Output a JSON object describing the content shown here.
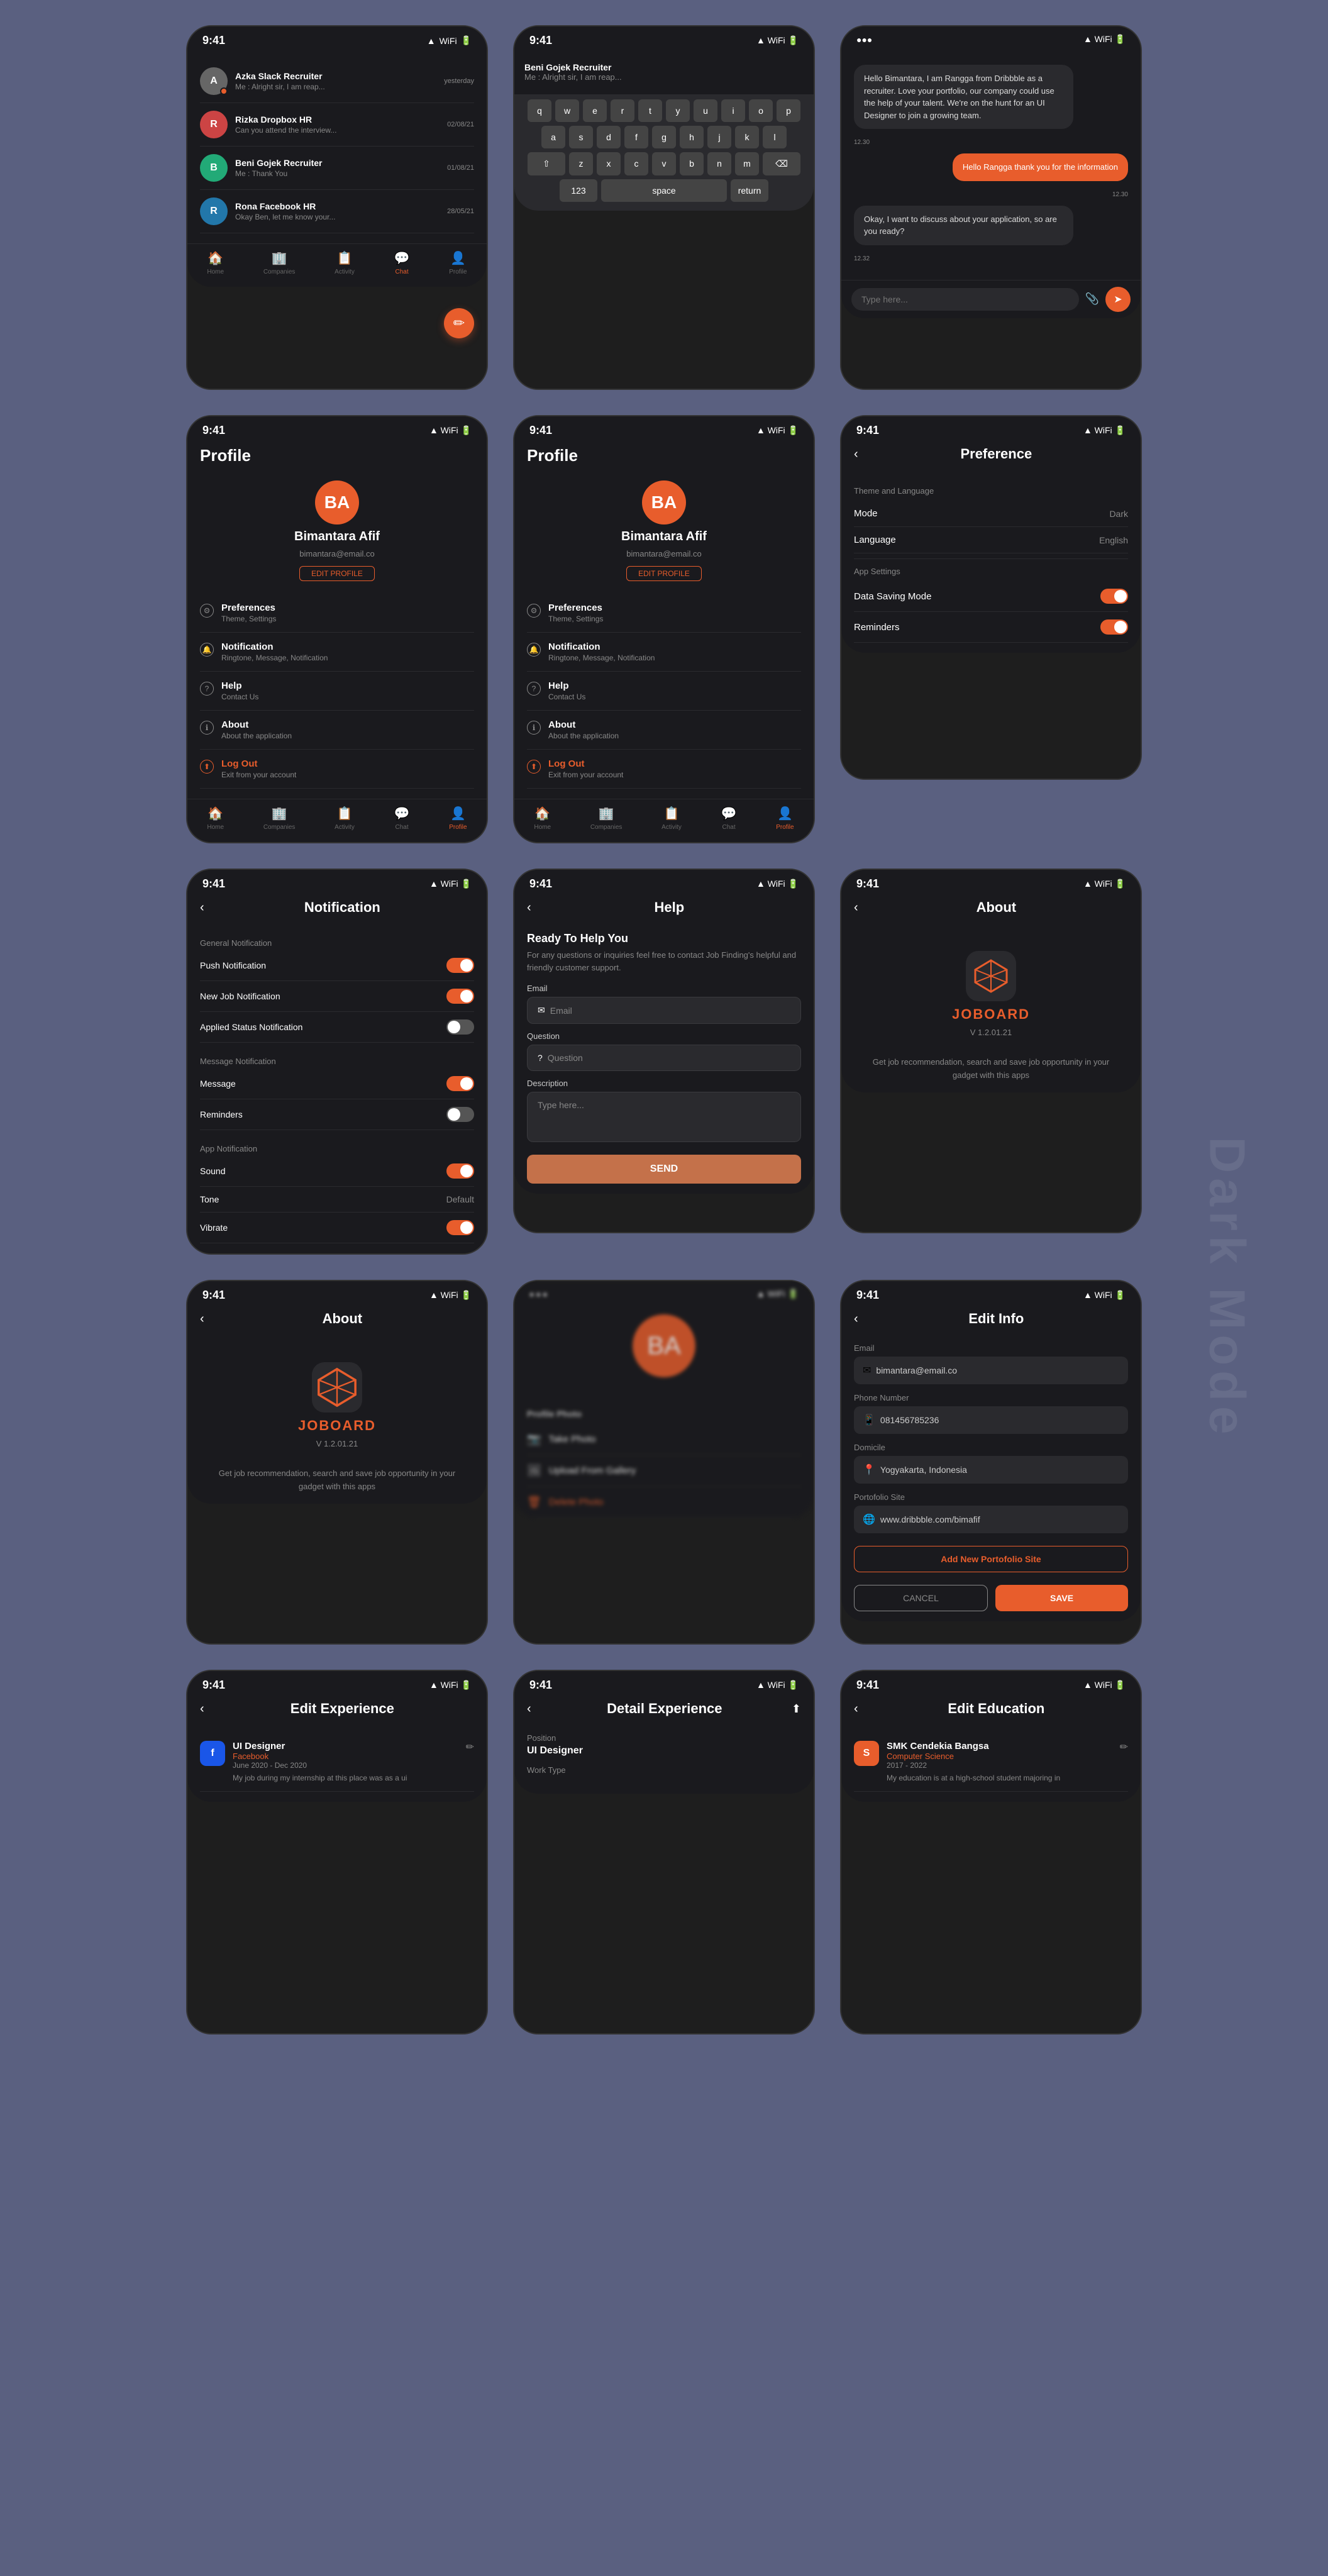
{
  "app": {
    "watermark": "Dark Mode"
  },
  "row1": {
    "phone1": {
      "status": {
        "time": "9:41",
        "icons": "▲ WiFi 🔋"
      },
      "chats": [
        {
          "name": "Azka Slack Recruiter",
          "preview": "Me : Alright sir, I am reap...",
          "time": "yesterday",
          "avatar": "A"
        },
        {
          "name": "Rizka Dropbox HR",
          "preview": "Can you attend the interview...",
          "time": "02/08/21",
          "avatar": "R"
        },
        {
          "name": "Beni Gojek Recruiter",
          "preview": "Me : Thank You",
          "time": "01/08/21",
          "avatar": "B"
        },
        {
          "name": "Rona Facebook HR",
          "preview": "Okay Ben, let me know your...",
          "time": "28/05/21",
          "avatar": "R2"
        }
      ],
      "fab": "+"
    },
    "phone2": {
      "status": {
        "time": "9:41"
      },
      "type": "keyboard-chat",
      "preview": "Me : Alright sir, I am reap...",
      "keyboard_rows": [
        [
          "q",
          "w",
          "e",
          "r",
          "t",
          "y",
          "u",
          "i",
          "o",
          "p"
        ],
        [
          "a",
          "s",
          "d",
          "f",
          "g",
          "h",
          "j",
          "k",
          "l"
        ],
        [
          "⇧",
          "z",
          "x",
          "c",
          "v",
          "b",
          "n",
          "m",
          "⌫"
        ],
        [
          "123",
          "space",
          "return"
        ]
      ]
    },
    "phone3": {
      "status": {
        "time": ""
      },
      "type": "message-thread",
      "messages": [
        {
          "type": "received",
          "text": "Hello Bimantara, I am Rangga from Dribbble as a recruiter. Love your portfolio, our company could use the help of your talent. We're on the hunt for an UI Designer to join a growing team.",
          "time": "12.30"
        },
        {
          "type": "sent",
          "text": "Hello Rangga thank you for the information",
          "time": "12.30"
        },
        {
          "type": "received",
          "text": "Okay, I want to discuss about your application, so are you ready?",
          "time": "12.32"
        }
      ],
      "input_placeholder": "Type here..."
    }
  },
  "row2": {
    "phone1": {
      "status": {
        "time": "9:41"
      },
      "type": "profile",
      "name": "Bimantara Afif",
      "email": "bimantara@email.co",
      "edit_label": "EDIT PROFILE",
      "menu_items": [
        {
          "icon": "⚙",
          "title": "Preferences",
          "subtitle": "Theme, Settings"
        },
        {
          "icon": "🔔",
          "title": "Notification",
          "subtitle": "Ringtone, Message, Notification"
        },
        {
          "icon": "?",
          "title": "Help",
          "subtitle": "Contact Us"
        },
        {
          "icon": "ℹ",
          "title": "About",
          "subtitle": "About the application"
        },
        {
          "icon": "⬆",
          "title": "Log Out",
          "subtitle": "Exit from your account",
          "type": "logout"
        }
      ],
      "nav": [
        "Home",
        "Companies",
        "Activity",
        "Chat",
        "Profile"
      ]
    },
    "phone2": {
      "status": {
        "time": "9:41"
      },
      "type": "profile",
      "name": "Bimantara Afif",
      "email": "bimantara@email.co",
      "edit_label": "EDIT PROFILE",
      "menu_items": [
        {
          "icon": "⚙",
          "title": "Preferences",
          "subtitle": "Theme, Settings"
        },
        {
          "icon": "🔔",
          "title": "Notification",
          "subtitle": "Ringtone, Message, Notification"
        },
        {
          "icon": "?",
          "title": "Help",
          "subtitle": "Contact Us"
        },
        {
          "icon": "ℹ",
          "title": "About",
          "subtitle": "About the application"
        },
        {
          "icon": "⬆",
          "title": "Log Out",
          "subtitle": "Exit from your account",
          "type": "logout"
        }
      ],
      "nav": [
        "Home",
        "Companies",
        "Activity",
        "Chat",
        "Profile"
      ]
    },
    "phone3": {
      "status": {
        "time": "9:41"
      },
      "type": "preference",
      "title": "Preference",
      "sections": [
        {
          "header": "Theme and Language",
          "items": [
            {
              "label": "Mode",
              "value": "Dark",
              "type": "text"
            },
            {
              "label": "Language",
              "value": "English",
              "type": "text"
            }
          ]
        },
        {
          "header": "App Settings",
          "items": [
            {
              "label": "Data Saving Mode",
              "value": "",
              "type": "toggle",
              "state": "on"
            },
            {
              "label": "Reminders",
              "value": "",
              "type": "toggle",
              "state": "on"
            }
          ]
        }
      ]
    }
  },
  "row3": {
    "phone1": {
      "status": {
        "time": "9:41"
      },
      "type": "notification",
      "title": "Notification",
      "sections": [
        {
          "header": "General Notification",
          "items": [
            {
              "label": "Push Notification",
              "type": "toggle",
              "state": "on"
            },
            {
              "label": "New Job Notification",
              "type": "toggle",
              "state": "on"
            },
            {
              "label": "Applied Status Notification",
              "type": "toggle",
              "state": "off"
            }
          ]
        },
        {
          "header": "Message Notification",
          "items": [
            {
              "label": "Message",
              "type": "toggle",
              "state": "on"
            },
            {
              "label": "Reminders",
              "type": "toggle",
              "state": "off"
            }
          ]
        },
        {
          "header": "App Notification",
          "items": [
            {
              "label": "Sound",
              "type": "toggle",
              "state": "on"
            },
            {
              "label": "Tone",
              "type": "text",
              "value": "Default"
            },
            {
              "label": "Vibrate",
              "type": "toggle",
              "state": "on"
            }
          ]
        }
      ]
    },
    "phone2": {
      "status": {
        "time": "9:41"
      },
      "type": "help",
      "title": "Help",
      "ready_title": "Ready To Help You",
      "ready_subtitle": "For any questions or inquiries feel free to contact Job Finding's helpful and friendly customer support.",
      "fields": [
        {
          "label": "Email",
          "placeholder": "Email",
          "icon": "✉"
        },
        {
          "label": "Question",
          "placeholder": "Question",
          "icon": "?"
        },
        {
          "label": "Description",
          "placeholder": "Type here...",
          "type": "textarea"
        }
      ],
      "submit_label": "SEND"
    },
    "phone3": {
      "status": {
        "time": "9:41"
      },
      "type": "about",
      "title": "About",
      "logo_name": "JOBOARD",
      "version": "V 1.2.01.21",
      "description": "Get job recommendation, search and save job opportunity in your gadget with this apps"
    }
  },
  "row4": {
    "phone1": {
      "status": {
        "time": "9:41"
      },
      "type": "about",
      "title": "About",
      "logo_name": "JOBOARD",
      "version": "V 1.2.01.21",
      "description": "Get job recommendation, search and save job opportunity in your gadget with this apps"
    },
    "phone2": {
      "status": {
        "time": ""
      },
      "type": "profile-photo",
      "blurred": true,
      "profile_photo_title": "Profile Photo",
      "options": [
        {
          "icon": "📷",
          "label": "Take Photo"
        },
        {
          "icon": "🖼",
          "label": "Upload From Gallery"
        },
        {
          "icon": "🗑",
          "label": "Delete Photo",
          "type": "delete"
        }
      ]
    },
    "phone3": {
      "status": {
        "time": "9:41"
      },
      "type": "edit-info",
      "title": "Edit Info",
      "fields": [
        {
          "label": "Email",
          "icon": "✉",
          "value": "bimantara@email.co"
        },
        {
          "label": "Phone Number",
          "icon": "📱",
          "value": "081456785236"
        },
        {
          "label": "Domicile",
          "icon": "📍",
          "value": "Yogyakarta, Indonesia"
        },
        {
          "label": "Portofolio Site",
          "icon": "🌐",
          "value": "www.dribbble.com/bimafif"
        }
      ],
      "add_portfolio_label": "Add New Portofolio Site",
      "cancel_label": "CANCEL",
      "save_label": "SAVE"
    }
  },
  "row5": {
    "phone1": {
      "status": {
        "time": "9:41"
      },
      "type": "edit-experience",
      "title": "Edit Experience",
      "experiences": [
        {
          "company_color": "#1a73e8",
          "logo_letter": "f",
          "title": "UI Designer",
          "company": "Facebook",
          "company_color_text": "#4267B2",
          "date": "June 2020 - Dec 2020",
          "description": "My job during my internship at this place was as a ui"
        }
      ]
    },
    "phone2": {
      "status": {
        "time": "9:41"
      },
      "type": "detail-experience",
      "title": "Detail Experience",
      "fields": [
        {
          "label": "Position",
          "value": "UI Designer"
        },
        {
          "label": "Work Type",
          "value": ""
        }
      ]
    },
    "phone3": {
      "status": {
        "time": "9:41"
      },
      "type": "edit-education",
      "title": "Edit Education",
      "educations": [
        {
          "logo_letter": "S",
          "logo_color": "#e85d2c",
          "school": "SMK Cendekia Bangsa",
          "major": "Computer Science",
          "date": "2017 - 2022",
          "description": "My education is at a high-school student majoring in"
        }
      ]
    }
  }
}
